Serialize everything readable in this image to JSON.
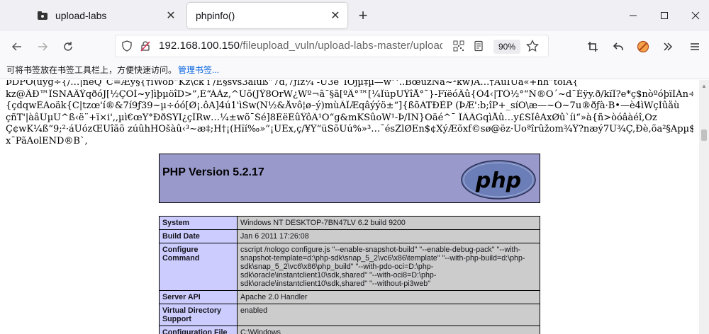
{
  "tabs": [
    {
      "title": "upload-labs",
      "active": false
    },
    {
      "title": "phpinfo()",
      "active": true
    }
  ],
  "url": {
    "host": "192.168.100.150",
    "path": "/fileupload_vuln/upload-labs-master/upload/",
    "zoom": "90%"
  },
  "bookmarks_bar": {
    "hint": "可将书签放在书签工具栏上，方便快速访问。",
    "link": "管理书签..."
  },
  "garbage_lines": [
    "ÞDPÔ(ûyg÷{/…|ñêQˆC=Æý§{†ìWob“Kz\\ck i /È§svš3ãlùß”7d,7ƒlz¼ -Û3êˆÎÓjµ‡µ—w^..BœužNâ~²kw)Ã…†AúÌÜâ«+hh”tõîÃ{",
    "kz@ÂÐ™ÎSNAÄŸqðóJ[½ÇÒÌ~y]ìþµöîD>”,É“ÁÁz,^Ùõ(JŸ8OrW¿Wº¬ã¯§ã[ºÂ°™[¼ÎüpUŸîÅ°˜}-FïëóÄû{Õ4‹|TÕ½°“Ñ®Ö´~d¯Éÿy.ð/kïÎ?e*ç$nòºóþïÍÁn÷°á´˜˜ã.",
    "{çdqwÈÃoäk{C|tzœ'í®&7í9ƒ39~µ÷óó[Ø¡.ôA]4ú1'ìŠw(Ñ½&Åvô¦ø–ý)mùÄÏÆqâýýö±“]{ßõÀTÐËP (ÞÆ':b;îP+_síO\\æ—~Ò~7u®ðƒà·B•—è4ìWçÌûåù",
    "çñT'|àâÛµÚ^ß‹ë¨+ï×i',,µì€œY°ÐðŠYI¿çÎRw…¼±wõ¯Šé]8ÉëÉûŸôÂ¹Ó“g&mKSûoW¹-Þ/ÍÑ}Oäé^¯ ÏÂÄGqìÅû…y£SÎêÃxØû`íi“»à{ñ>òóâàéî,Oz",
    "Ç¢wK¼ß“9;²·áÛózŒÜîãõ zúûhHÓšàû‹³~æ‡;H†¡(Hïí‰»“¡ÙËx,ç/¥Ÿ“üŠõUú%»³…¯ésŽlØEn$¢XýÆõxf©sø@ëz·Úoªîrûžom¾Ÿ?næý7Ù¾Ç,Ðè,õa²§Apµ$,þ¿nGx",
    "x¯PãÃolEND®B`,"
  ],
  "phpinfo": {
    "version_title": "PHP Version 5.2.17",
    "rows": [
      {
        "key": "System",
        "value": "Windows NT DESKTOP-7BN47LV 6.2 build 9200"
      },
      {
        "key": "Build Date",
        "value": "Jan 6 2011 17:26:08"
      },
      {
        "key": "Configure Command",
        "value": "cscript /nologo configure.js \"--enable-snapshot-build\" \"--enable-debug-pack\" \"--with-snapshot-template=d:\\php-sdk\\snap_5_2\\vc6\\x86\\template\" \"--with-php-build=d:\\php-sdk\\snap_5_2\\vc6\\x86\\php_build\" \"--with-pdo-oci=D:\\php-sdk\\oracle\\instantclient10\\sdk,shared\" \"--with-oci8=D:\\php-sdk\\oracle\\instantclient10\\sdk,shared\" \"--without-pi3web\""
      },
      {
        "key": "Server API",
        "value": "Apache 2.0 Handler"
      },
      {
        "key": "Virtual Directory Support",
        "value": "enabled"
      },
      {
        "key": "Configuration File",
        "value": "C:\\Windows"
      }
    ]
  }
}
